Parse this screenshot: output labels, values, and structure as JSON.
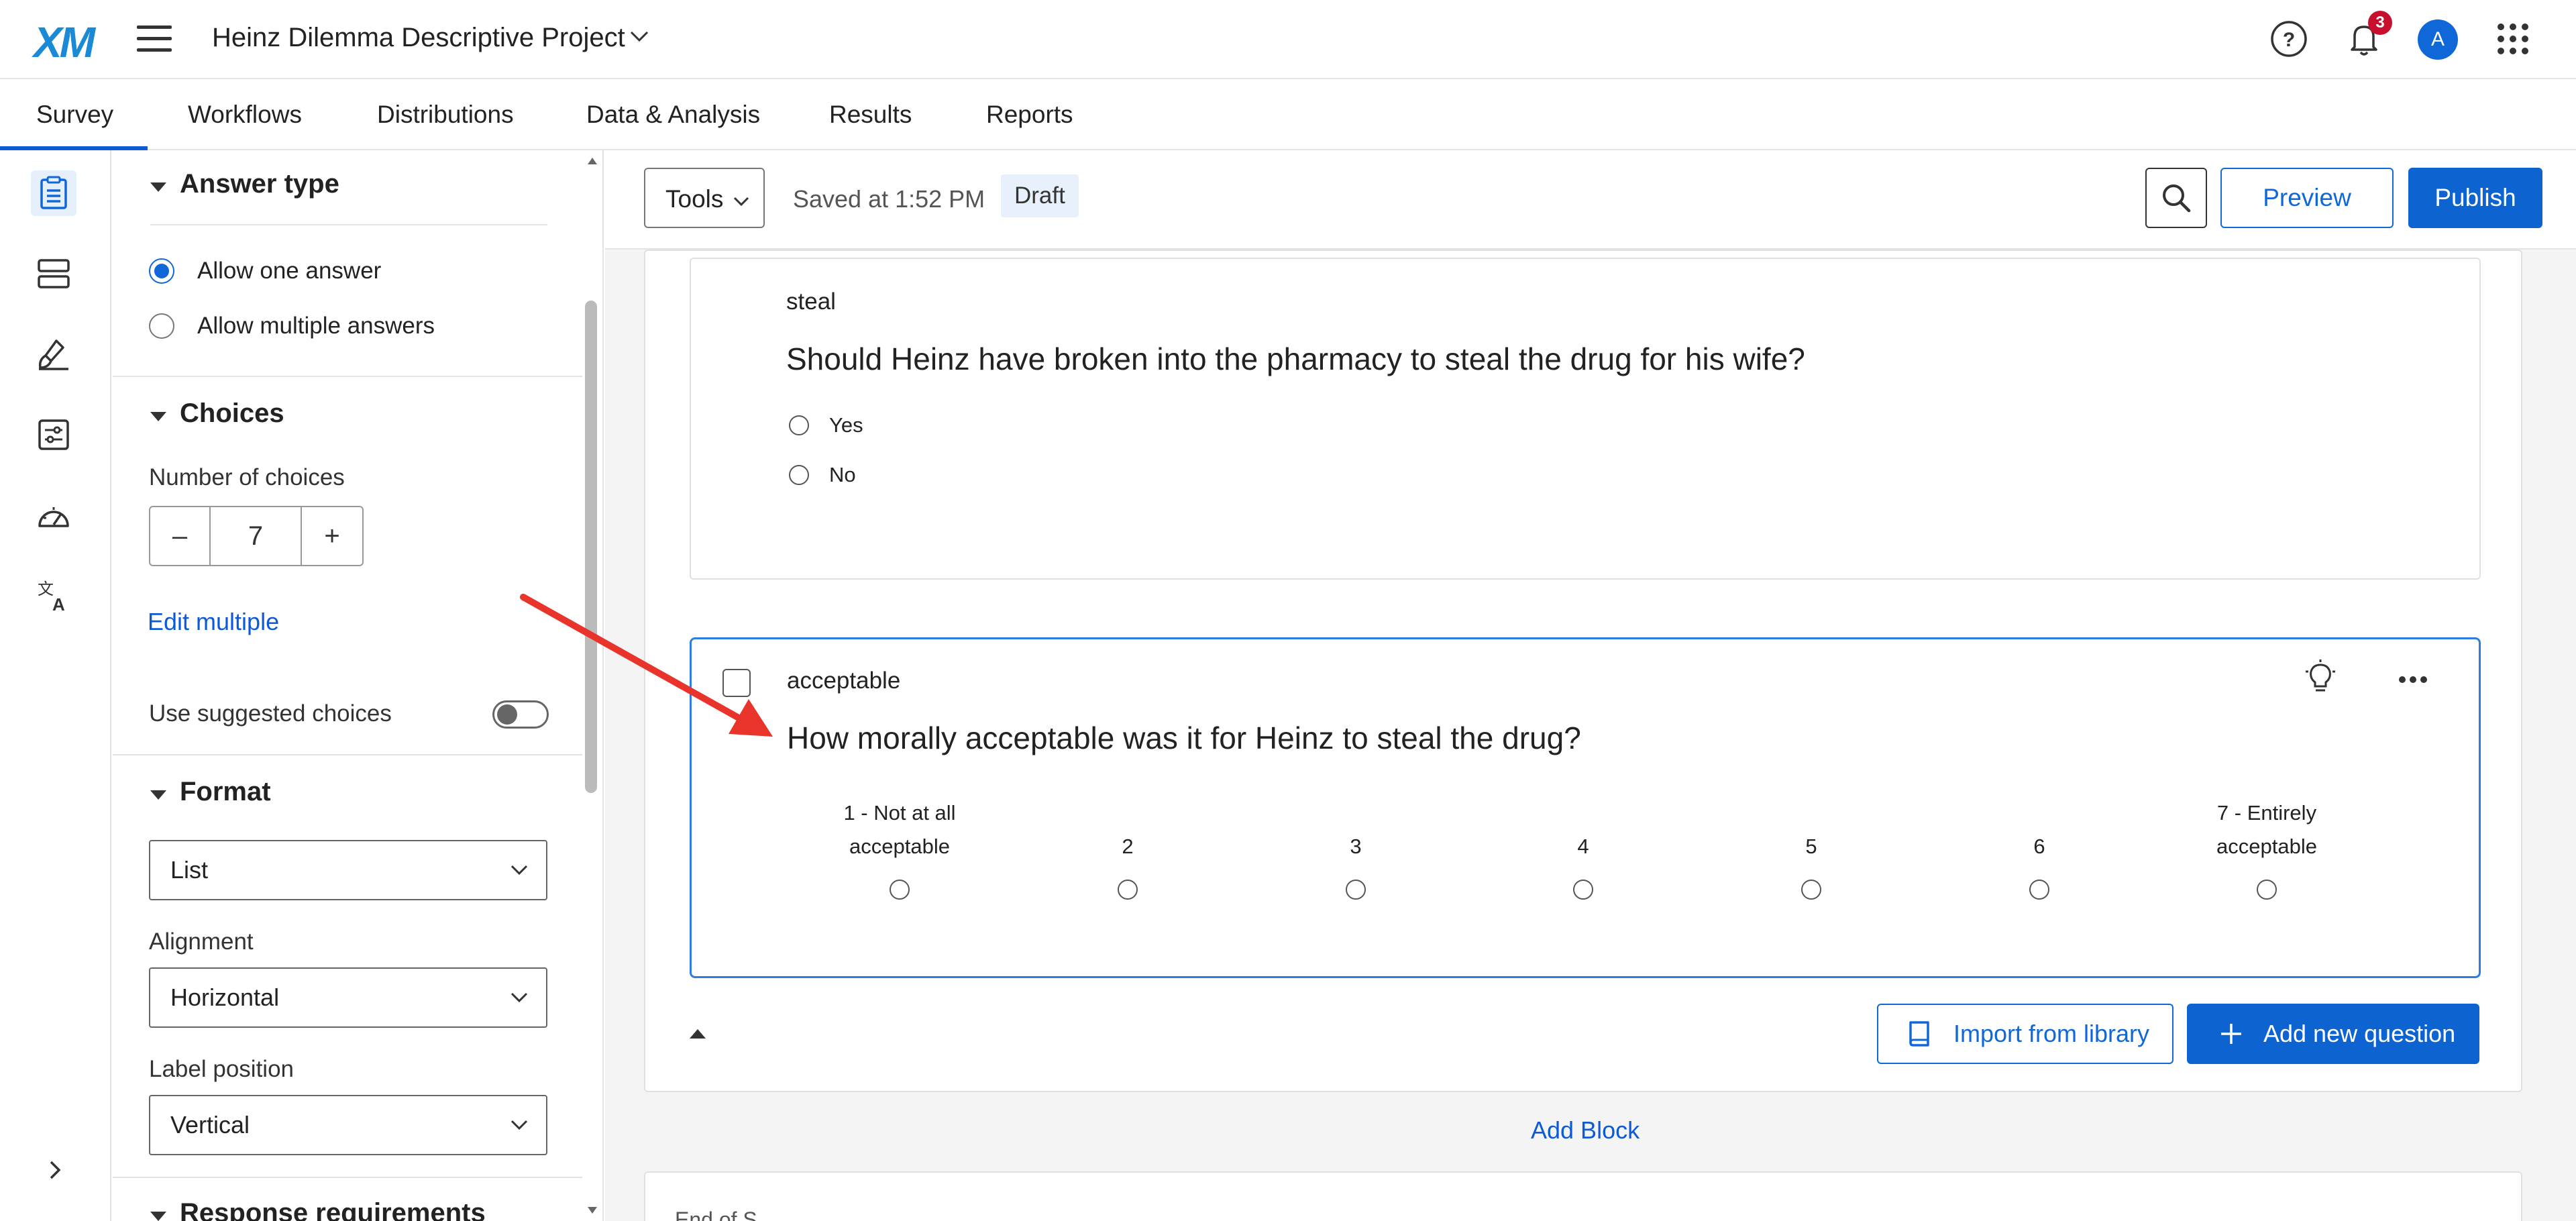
{
  "app": {
    "logo": "XM",
    "project_title": "Heinz Dilemma Descriptive Project",
    "notification_count": "3",
    "avatar_initial": "A"
  },
  "tabs": [
    {
      "label": "Survey",
      "active": true
    },
    {
      "label": "Workflows"
    },
    {
      "label": "Distributions"
    },
    {
      "label": "Data & Analysis"
    },
    {
      "label": "Results"
    },
    {
      "label": "Reports"
    }
  ],
  "rail": {
    "icons": [
      "survey-icon",
      "survey-flow-icon",
      "look-and-feel-icon",
      "survey-options-icon",
      "tools-icon",
      "translate-icon"
    ]
  },
  "panel": {
    "answer_type": {
      "heading": "Answer type",
      "options": [
        {
          "label": "Allow one answer",
          "selected": true
        },
        {
          "label": "Allow multiple answers",
          "selected": false
        }
      ]
    },
    "choices": {
      "heading": "Choices",
      "number_label": "Number of choices",
      "number_value": "7",
      "minus": "–",
      "plus": "+",
      "edit_multiple": "Edit multiple",
      "suggested_label": "Use suggested choices",
      "suggested_on": false
    },
    "format": {
      "heading": "Format",
      "type_value": "List",
      "alignment_label": "Alignment",
      "alignment_value": "Horizontal",
      "label_position_label": "Label position",
      "label_position_value": "Vertical"
    },
    "response_requirements": {
      "heading": "Response requirements"
    }
  },
  "toolbar": {
    "tools_label": "Tools",
    "saved_text": "Saved at 1:52 PM",
    "draft_label": "Draft",
    "preview_label": "Preview",
    "publish_label": "Publish"
  },
  "questions": [
    {
      "id": "steal",
      "text": "Should Heinz have broken into the pharmacy to steal the drug for his wife?",
      "choices": [
        "Yes",
        "No"
      ]
    },
    {
      "id": "acceptable",
      "text": "How morally acceptable was it for Heinz to steal the drug?",
      "scale": [
        {
          "line1": "1 - Not at all",
          "line2": "acceptable"
        },
        {
          "line1": "",
          "line2": "2"
        },
        {
          "line1": "",
          "line2": "3"
        },
        {
          "line1": "",
          "line2": "4"
        },
        {
          "line1": "",
          "line2": "5"
        },
        {
          "line1": "",
          "line2": "6"
        },
        {
          "line1": "7 - Entirely",
          "line2": "acceptable"
        }
      ]
    }
  ],
  "block_actions": {
    "import_label": "Import from library",
    "add_question_label": "Add new question",
    "add_block_label": "Add Block"
  },
  "end_block": {
    "text": "End of S..."
  },
  "colors": {
    "accent": "#0d63d0",
    "selected_question_border": "#2f7de1",
    "annotation_arrow": "#e8342b",
    "notification_badge": "#c8102e"
  }
}
